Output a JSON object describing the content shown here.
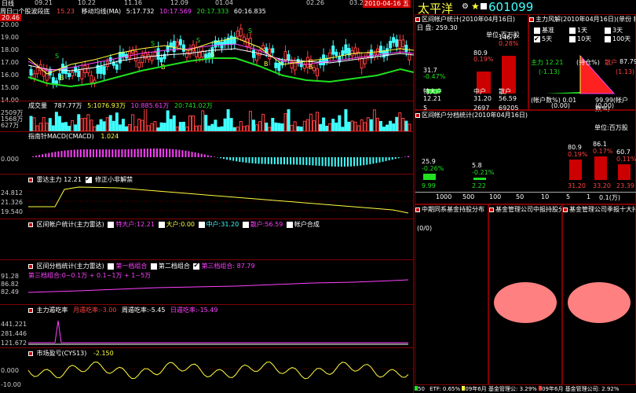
{
  "top": {
    "period": "日线",
    "dates": [
      "09.21",
      "10.22",
      "11.16",
      "12.09",
      "01.04",
      "02.26",
      "03.2"
    ],
    "date_badge": "2010-04-16 五",
    "ytop": "20.46"
  },
  "main": {
    "title": "周日□个股波段底",
    "val1": "15.23",
    "ma_label": "移动均线(MA)",
    "ma_vals": [
      "5:17.732",
      "10:17.569",
      "20:17.333",
      "60:16.835"
    ],
    "yticks": [
      "20.00",
      "19.00",
      "18.00",
      "17.00",
      "16.00",
      "15.00",
      "14.00"
    ],
    "marks": [
      {
        "t": "S",
        "c": "#20e020"
      },
      {
        "t": "B",
        "c": "#ffff40"
      }
    ]
  },
  "vol": {
    "label": "成交量",
    "val": "787.77万",
    "ma5": "5:1076.93万",
    "ma10": "10:885.61万",
    "ma20": "20:741.02万",
    "yticks": [
      "2509万",
      "1568万",
      "627万"
    ]
  },
  "macd": {
    "label": "指南针MACD(CMACD)",
    "val": "1.024",
    "ytick": "0.000"
  },
  "radar": {
    "label": "雷达主力 12.21",
    "chk": "修正小非解禁",
    "yticks": [
      "24.812",
      "21.326",
      "19.540"
    ]
  },
  "zone1": {
    "label": "区间帐户统计(主力雷达)",
    "items": [
      "特大户:12.21",
      "大户:0.00",
      "中户:31.20",
      "散户:56.59",
      "帐户合成"
    ]
  },
  "zone2": {
    "label": "区间分档统计(主力雷达)",
    "items": [
      "第一档组合",
      "第二档组合",
      "第三档组合: 87.79"
    ],
    "sub": "第三档组合:0~0.1万 + 0.1~1万 + 1~5万",
    "yticks": [
      "91.28",
      "86.82",
      "82.49"
    ]
  },
  "eat": {
    "label": "主力遁吃率",
    "items": [
      "月遁吃率:-3.00",
      "周遁吃率:-5.45",
      "日遁吃率:-15.49"
    ],
    "yticks": [
      "441.221",
      "281.446",
      "121.672"
    ]
  },
  "pl": {
    "label": "市场盈亏(CYS13)",
    "val": "-2.150",
    "yticks": [
      "0.000",
      "-10.00"
    ]
  },
  "right": {
    "name": "太平洋",
    "code": "601099",
    "acct_title": "区间帐户统计(2010年04月16日)",
    "risk_title": "主力风解(2010年04月16日)(单份 积耗)",
    "acct_day": "日 盘: 259.30",
    "unit": "单位:百万股",
    "acct_bars": [
      {
        "top": "31.7",
        "pct": "-0.47%",
        "name": "特大户",
        "v1": "12.21",
        "v2": "5"
      },
      {
        "top": "",
        "pct": "",
        "name": "",
        "v1": "",
        "v2": ""
      },
      {
        "top": "80.9",
        "pct": "0.19%",
        "name": "中户",
        "v1": "31.20",
        "v2": "2697"
      },
      {
        "top": "146.7",
        "pct": "0.28%",
        "name": "散户",
        "v1": "56.59",
        "v2": "69205"
      }
    ],
    "risk_opts": [
      "基准",
      "1天",
      "3天",
      "5天",
      "10天",
      "100天"
    ],
    "risk_vals": {
      "zl": "主力 12.21",
      "zl2": "(-1.13)",
      "sh": "(持仓%)",
      "sh2": "散户",
      "v3": "87.79",
      "v4": "(1.13)",
      "pz": "(帐户数%) 0.01",
      "pz2": "(0.00)",
      "pz3": "99.99(帐户数%)",
      "pz4": "(0.00)"
    },
    "grade_title": "区间帐户分档统计(2010年04月16日)",
    "grade_unit": "单位:百万股",
    "grade": [
      {
        "top": "25.9",
        "pct": "-0.26%",
        "v": "9.99"
      },
      {
        "top": "5.8",
        "pct": "-0.21%",
        "v": "2.22"
      },
      {
        "top": "80.9",
        "pct": "0.19%",
        "v": "31.20"
      },
      {
        "top": "86.1",
        "pct": "0.17%",
        "v": "33.20"
      },
      {
        "top": "60.7",
        "pct": "0.11%",
        "v": "23.39"
      }
    ],
    "grade_x": [
      "1000",
      "500",
      "100",
      "50",
      "10",
      "5",
      "1",
      "0.1(万)"
    ],
    "tabs": [
      "中期同系基金持股分布",
      "基金管理公司中报持股分",
      "基金管理公司季报十大持"
    ],
    "tab_val": "(0/0)",
    "footer": [
      "50",
      "ETF: 0.65%",
      "09年6月",
      "基金管理公: 3.29%",
      "09年6月",
      "基金管理公司: 2.92%",
      "09年6月"
    ]
  }
}
